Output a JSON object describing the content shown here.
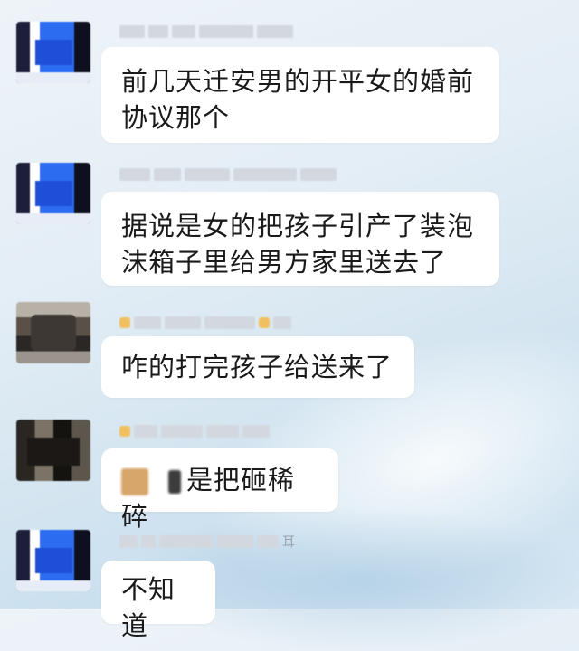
{
  "messages": [
    {
      "text_line1": "前几天迁安男的开平女的婚前",
      "text_line2": "协议那个"
    },
    {
      "text_line1": "据说是女的把孩子引产了装泡",
      "text_line2": "沫箱子里给男方家里送去了"
    },
    {
      "text": "咋的打完孩子给送来了"
    },
    {
      "text": "是把砸稀碎"
    },
    {
      "text": "不知道",
      "name_visible_char": "耳"
    }
  ]
}
